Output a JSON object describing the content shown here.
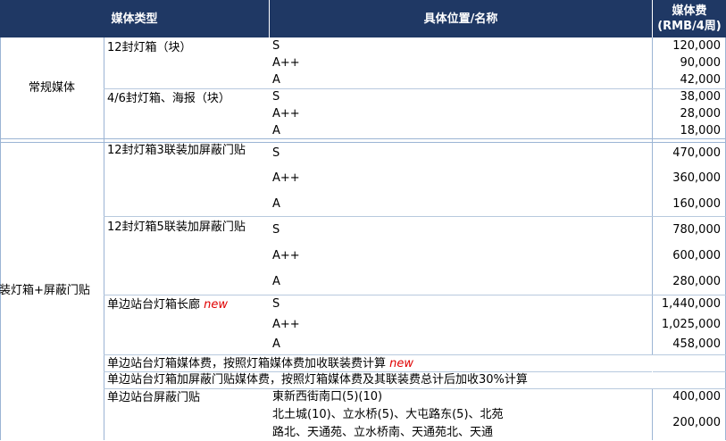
{
  "header": {
    "col1": "媒体类型",
    "col2": "具体位置/名称",
    "col3_line1": "媒体费",
    "col3_line2": "(RMB/4周)"
  },
  "groups": {
    "regular": "常规媒体",
    "combo": "联装灯箱+屏蔽门贴"
  },
  "rows": {
    "r1": {
      "name": "12封灯箱（块）",
      "levels": [
        "S",
        "A++",
        "A"
      ],
      "prices": [
        "120,000",
        "90,000",
        "42,000"
      ]
    },
    "r2": {
      "name": "4/6封灯箱、海报（块）",
      "levels": [
        "S",
        "A++",
        "A"
      ],
      "prices": [
        "38,000",
        "28,000",
        "18,000"
      ]
    },
    "r3": {
      "name": "12封灯箱3联装加屏蔽门贴",
      "levels": [
        "S",
        "A++",
        "A"
      ],
      "prices": [
        "470,000",
        "360,000",
        "160,000"
      ]
    },
    "r4": {
      "name": "12封灯箱5联装加屏蔽门贴",
      "levels": [
        "S",
        "A++",
        "A"
      ],
      "prices": [
        "780,000",
        "600,000",
        "280,000"
      ]
    },
    "r5": {
      "name": "单边站台灯箱长廊",
      "badge": "new",
      "levels": [
        "S",
        "A++",
        "A"
      ],
      "prices": [
        "1,440,000",
        "1,025,000",
        "458,000"
      ]
    }
  },
  "notes": {
    "n1": "单边站台灯箱媒体费，按照灯箱媒体费加收联装费计算",
    "n1_badge": "new",
    "n2": "单边站台灯箱加屏蔽门贴媒体费，按照灯箱媒体费及其联装费总计后加收30%计算"
  },
  "last": {
    "name": "单边站台屏蔽门贴",
    "loc1": "東新西街南口(5)(10)",
    "price1": "400,000",
    "loc2_line1": "北土城(10)、立水桥(5)、大屯路东(5)、北苑",
    "loc2_line2": "路北、天通苑、立水桥南、天通苑北、天通",
    "price2": "200,000"
  }
}
